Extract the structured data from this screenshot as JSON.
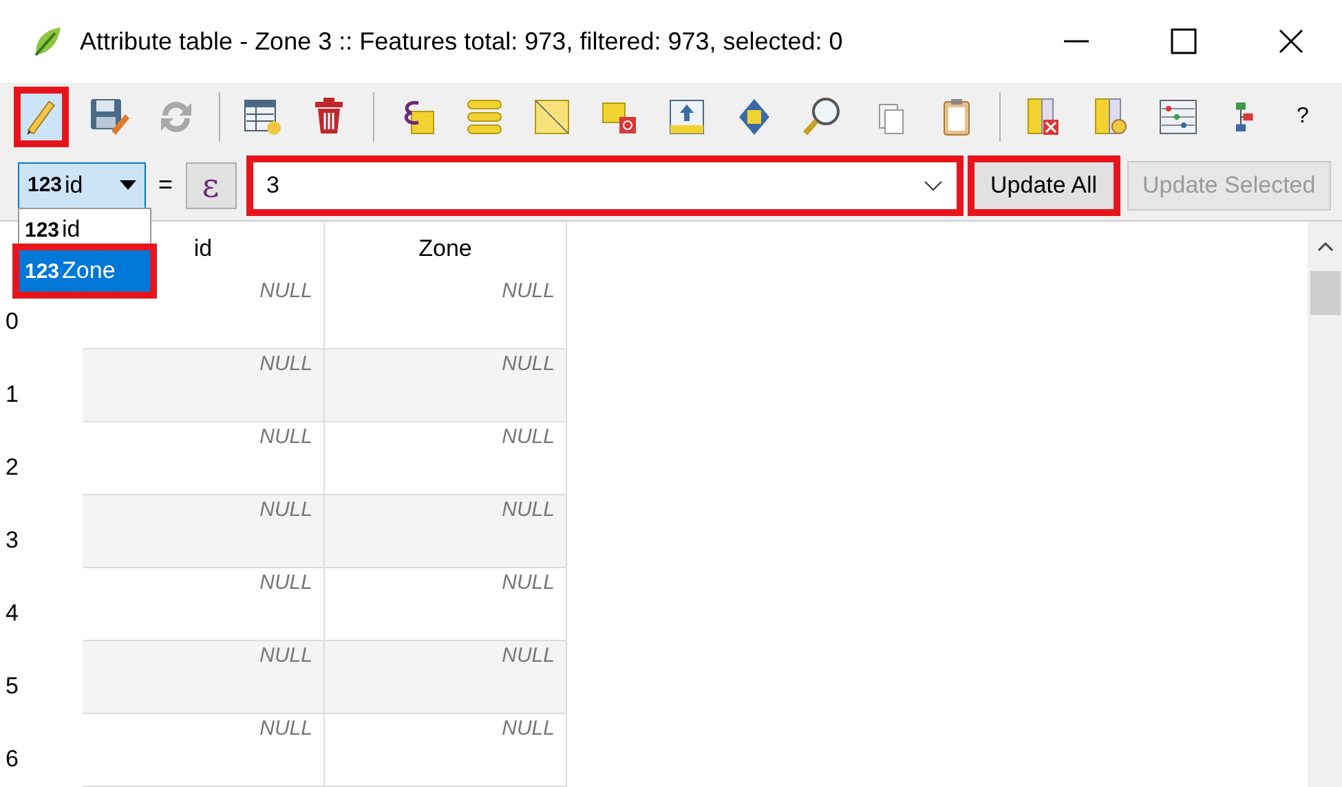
{
  "window": {
    "title": "Attribute table - Zone 3 :: Features total: 973, filtered: 973, selected: 0"
  },
  "toolbar": {
    "edit_mode": {
      "on": true,
      "highlighted": true
    },
    "help": "?"
  },
  "field_calculator": {
    "field": {
      "type_badge": "123",
      "label": "id",
      "options": [
        {
          "type_badge": "123",
          "label": "id",
          "selected": false,
          "highlighted": false
        },
        {
          "type_badge": "123",
          "label": "Zone",
          "selected": true,
          "highlighted": true
        }
      ]
    },
    "equals": "=",
    "expression_button": "ε",
    "expression": {
      "value": "3",
      "highlighted": true
    },
    "buttons": [
      {
        "label": "Update All",
        "disabled": false,
        "highlighted": true
      },
      {
        "label": "Update Selected",
        "disabled": true,
        "highlighted": false
      }
    ]
  },
  "table": {
    "columns": [
      "id",
      "Zone"
    ],
    "rows": [
      {
        "header": "0",
        "cells": [
          "NULL",
          "NULL"
        ]
      },
      {
        "header": "1",
        "cells": [
          "NULL",
          "NULL"
        ]
      },
      {
        "header": "2",
        "cells": [
          "NULL",
          "NULL"
        ]
      },
      {
        "header": "3",
        "cells": [
          "NULL",
          "NULL"
        ]
      },
      {
        "header": "4",
        "cells": [
          "NULL",
          "NULL"
        ]
      },
      {
        "header": "5",
        "cells": [
          "NULL",
          "NULL"
        ]
      },
      {
        "header": "6",
        "cells": [
          "NULL",
          "NULL"
        ]
      }
    ]
  }
}
